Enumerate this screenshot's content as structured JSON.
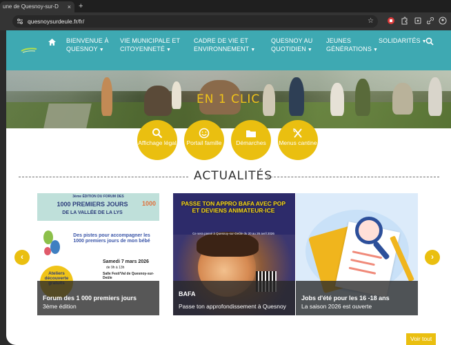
{
  "browser": {
    "tab_title": "une de Quesnoy-sur-D",
    "tab_close": "×",
    "new_tab": "+",
    "url": "quesnoysurdeule.fr/fr/"
  },
  "nav": {
    "items": [
      {
        "label": "BIENVENUE À QUESNOY"
      },
      {
        "label": "VIE MUNICIPALE ET CITOYENNETÉ"
      },
      {
        "label": "CADRE DE VIE ET ENVIRONNEMENT"
      },
      {
        "label": "QUESNOY AU QUOTIDIEN"
      },
      {
        "label": "JEUNES GÉNÉRATIONS"
      },
      {
        "label": "SOLIDARITÉS"
      }
    ]
  },
  "hero": {
    "title": "EN 1 CLIC"
  },
  "quick_links": [
    {
      "label": "Affichage légal",
      "icon": "search-icon"
    },
    {
      "label": "Portail famille",
      "icon": "smile-icon"
    },
    {
      "label": "Démarches",
      "icon": "folder-icon"
    },
    {
      "label": "Menus cantine",
      "icon": "fork-knife-icon"
    }
  ],
  "news": {
    "title": "ACTUALITÉS",
    "prev": "‹",
    "next": "›",
    "cards": [
      {
        "title": "Forum des 1 000 premiers jours",
        "subtitle": "3ème édition",
        "poster": {
          "edition": "3ème ÉDITION DU FORUM DES",
          "headline": "1000 PREMIERS JOURS",
          "sub": "DE LA VALLÉE DE LA LYS",
          "brand": "1000",
          "pitch": "Des pistes pour accompagner les 1000 premiers jours de mon bébé",
          "date": "Samedi 7 mars 2026",
          "hours": "de 9h à 13h",
          "venue": "Salle Festi'Val de Quesnoy-sur-Deûle",
          "workshops": "Ateliers découverte gratuits"
        }
      },
      {
        "title": "BAFA",
        "subtitle": "Passe ton approfondissement à Quesnoy",
        "poster": {
          "headline": "PASSE TON APPRO BAFA AVEC POP ET DEVIENS ANIMATEUR·ICE",
          "sub": "Ce sera passé à Quesnoy-sur-Deûle du 20 au 26 avril 2026"
        }
      },
      {
        "title": "Jobs d'été pour les 16 -18 ans",
        "subtitle": "La saison 2026 est ouverte"
      }
    ]
  },
  "footer": {
    "see_all": "Voir tout"
  },
  "colors": {
    "teal": "#3ea9b2",
    "yellow": "#eabf10"
  }
}
